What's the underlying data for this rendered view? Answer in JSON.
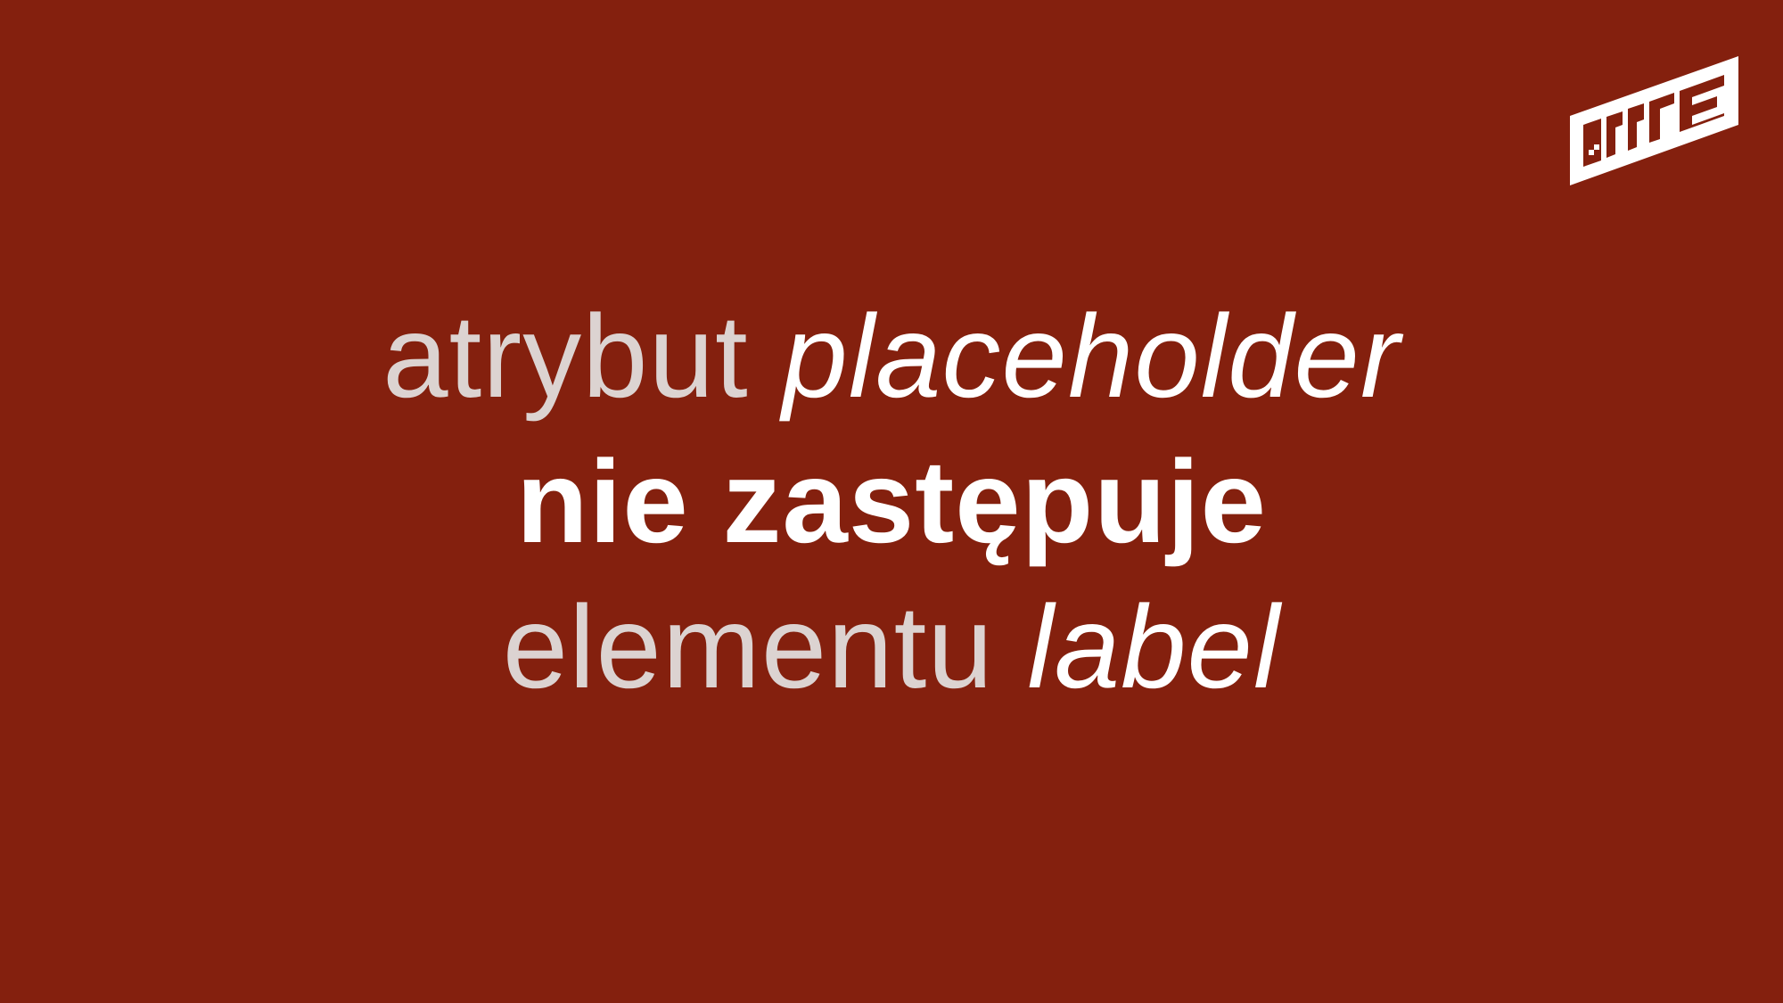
{
  "brand": {
    "logo_icon": "brand-logo-icon",
    "accent": "#84200e",
    "text_light": "#dcd3d1",
    "text_white": "#ffffff"
  },
  "headline": {
    "line1": {
      "prefix": "atrybut ",
      "code": "placeholder"
    },
    "line2": {
      "text": "nie zastępuje"
    },
    "line3": {
      "prefix": "elementu ",
      "code": "label"
    }
  }
}
